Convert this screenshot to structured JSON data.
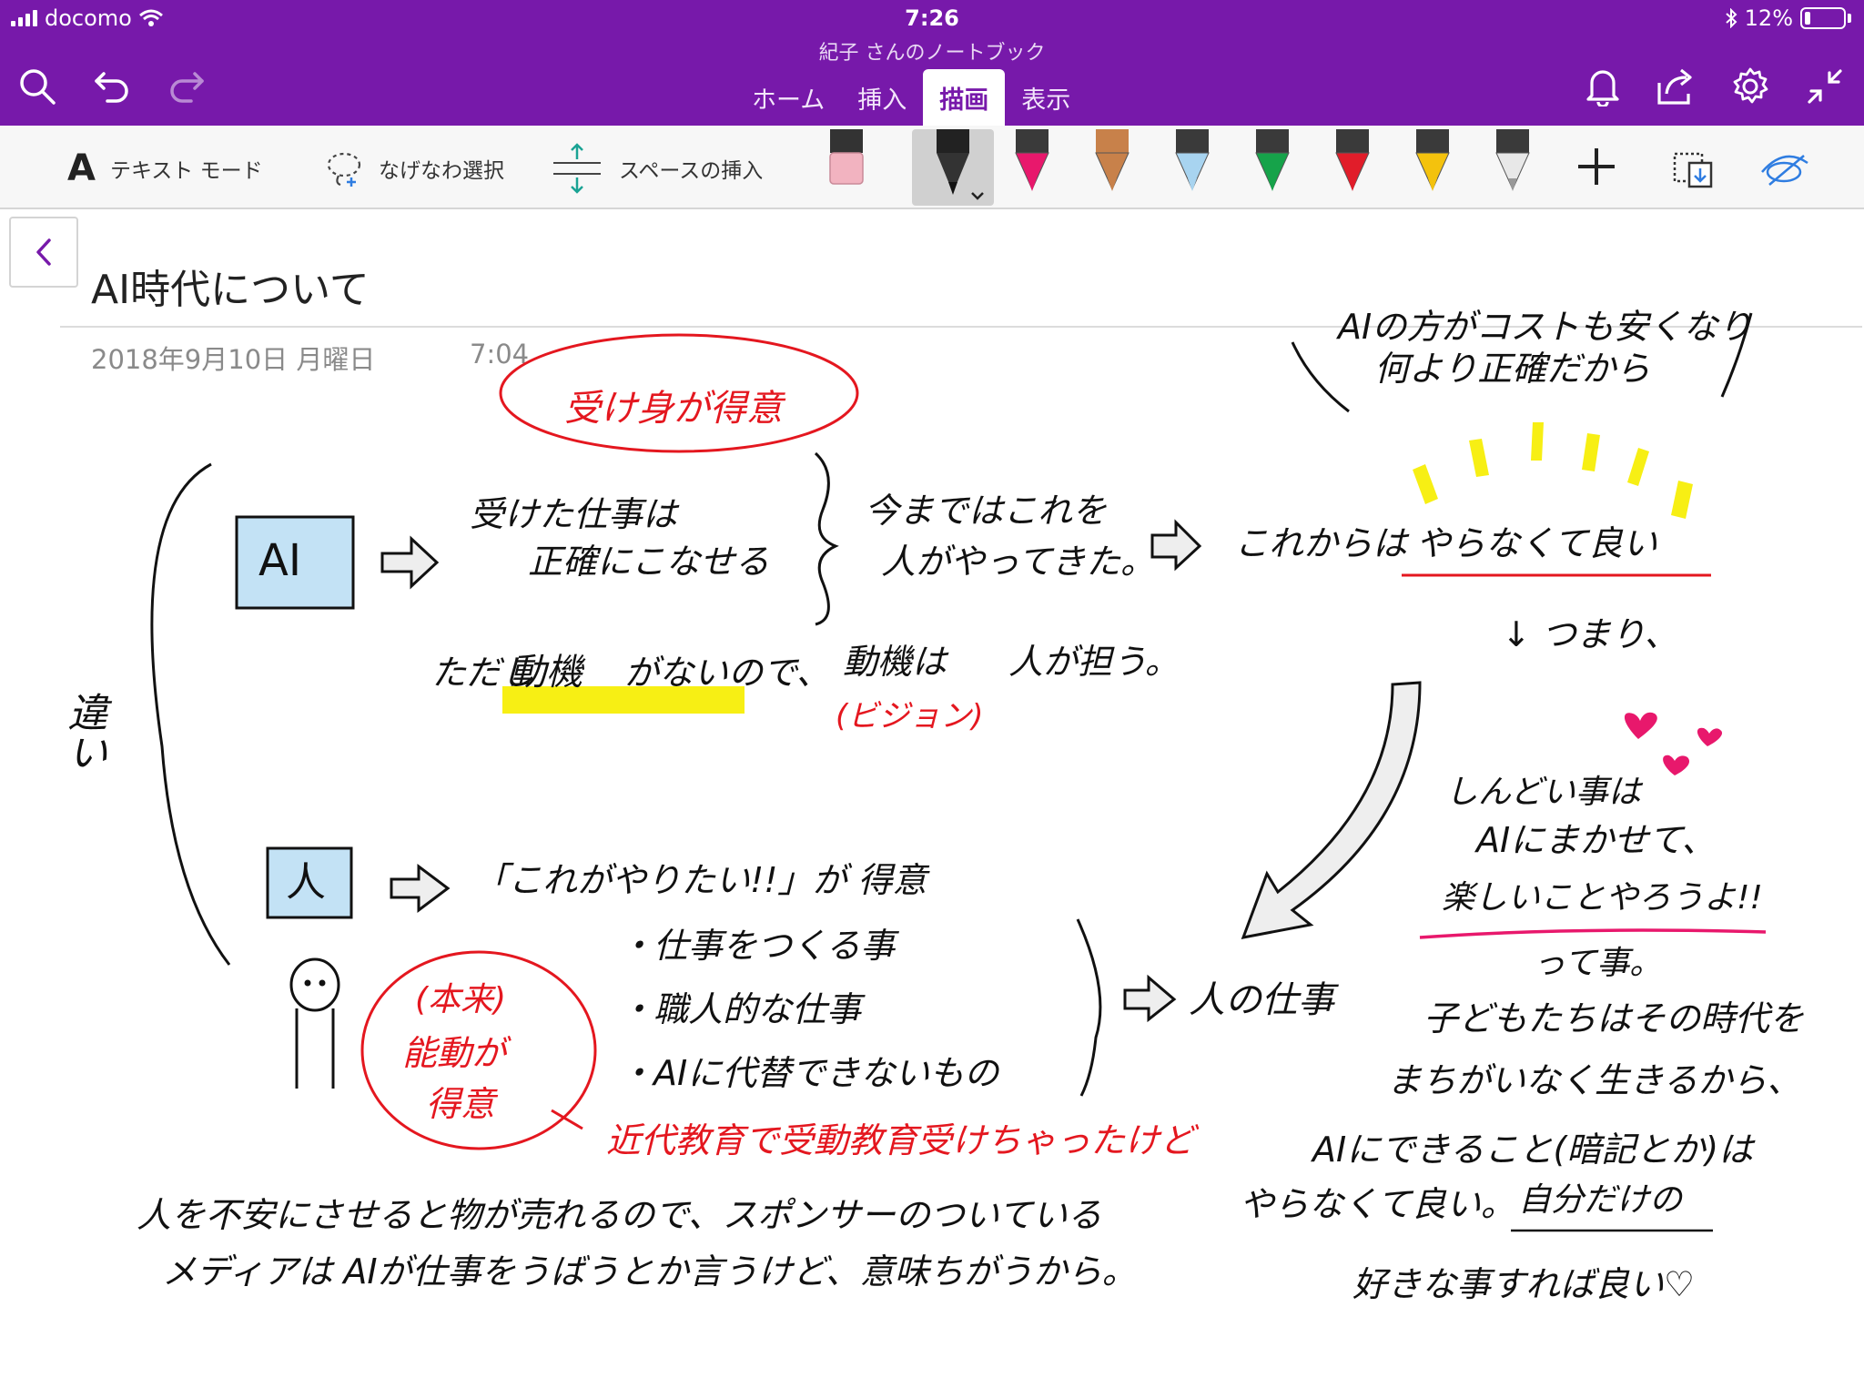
{
  "status_bar": {
    "carrier": "docomo",
    "time": "7:26",
    "battery": "12%"
  },
  "header": {
    "notebook_title": "紀子 さんのノートブック",
    "tabs": [
      {
        "label": "ホーム",
        "active": false
      },
      {
        "label": "挿入",
        "active": false
      },
      {
        "label": "描画",
        "active": true
      },
      {
        "label": "表示",
        "active": false
      }
    ],
    "icons": [
      "search-icon",
      "undo-icon",
      "redo-icon",
      "bell-icon",
      "share-icon",
      "gear-icon",
      "collapse-icon"
    ]
  },
  "ribbon": {
    "text_mode": "テキスト モード",
    "text_mode_glyph": "A",
    "lasso_select": "なげなわ選択",
    "insert_space": "スペースの挿入",
    "pens": [
      {
        "name": "eraser",
        "color": "#f2b3c0"
      },
      {
        "name": "black",
        "color": "#111111",
        "selected": true
      },
      {
        "name": "pink",
        "color": "#e8186c"
      },
      {
        "name": "pencil",
        "color": "#c8814a"
      },
      {
        "name": "light-blue",
        "color": "#a8d4f0"
      },
      {
        "name": "green",
        "color": "#16a34a"
      },
      {
        "name": "red",
        "color": "#e11d2a"
      },
      {
        "name": "yellow",
        "color": "#f4c20d"
      },
      {
        "name": "white",
        "color": "#e8e8e8"
      }
    ]
  },
  "page": {
    "title": "AI時代について",
    "date": "2018年9月10日 月曜日",
    "time": "7:04"
  },
  "ink": {
    "passive_bubble": "受け身が得意",
    "ai_box": "AI",
    "ai_desc_1": "受けた仕事は",
    "ai_desc_2": "正確にこなせる",
    "until_now_1": "今まではこれを",
    "until_now_2": "人がやってきた。",
    "from_now_1": "これからは",
    "from_now_2": "やらなくて良い",
    "cost_1": "AIの方がコストも安くなり",
    "cost_2": "何より正確だから",
    "however": "ただし",
    "motive": "動機",
    "no_motive": "がないので、",
    "motive_2": "動機は",
    "human_role": "人が担う。",
    "vision": "(ビジョン)",
    "difference": "違い",
    "therefore": "↓ つまり、",
    "human_box": "人",
    "good_at": "「これがやりたい!!」が 得意",
    "task_1": "・仕事をつくる事",
    "task_2": "・職人的な仕事",
    "task_3": "・AIに代替できないもの",
    "human_job": "人の仕事",
    "original_1": "(本来)",
    "original_2": "能動が",
    "original_3": "得意",
    "modern_edu": "近代教育で受動教育受けちゃったけど",
    "hard_1": "しんどい事は",
    "hard_2": "AIにまかせて、",
    "hard_3": "楽しいことやろうよ!!",
    "hard_4": "って事。",
    "kids_1": "子どもたちはその時代を",
    "kids_2": "まちがいなく生きるから、",
    "kids_3": "AIにできること(暗記とか)は",
    "kids_4": "やらなくて良い。",
    "own": "自分だけの",
    "kids_5": "好きな事すれば良い♡",
    "media_1": "人を不安にさせると物が売れるので、スポンサーのついている",
    "media_2": "メディアは AIが仕事をうばうとか言うけど、意味ちがうから。"
  }
}
